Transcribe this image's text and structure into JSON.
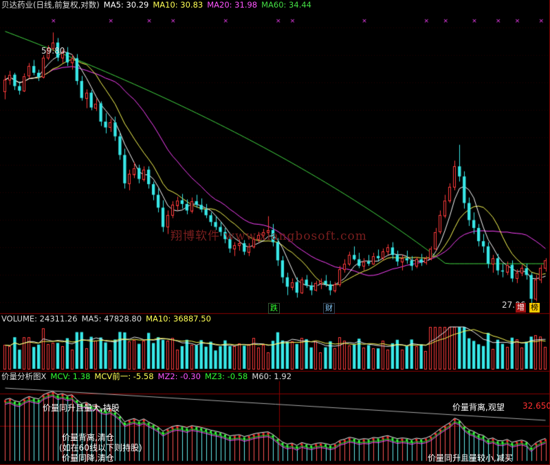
{
  "colors": {
    "up": "#ff3b3b",
    "down": "#38e8e8",
    "ma5": "#ffffff",
    "ma10": "#ffff55",
    "ma20": "#ff44ff",
    "ma60": "#44dd44",
    "divider": "#8b0000",
    "white": "#eeeeee",
    "yellow": "#ffff00",
    "green": "#33ff33",
    "magenta": "#ff55ff",
    "red": "#ff2a2a",
    "wm": "#7a1e1e"
  },
  "header": {
    "name": "贝达药业(日线,前复权,对数)",
    "ma5": "MA5: 30.29",
    "ma10": "MA10: 30.83",
    "ma20": "MA20: 31.98",
    "ma60": "MA60: 34.44"
  },
  "price_panel": {
    "high_label": "59.80",
    "low_label": "27.06",
    "tags": [
      "跌",
      "财",
      "增",
      "榜"
    ]
  },
  "watermark": "翔博软件 www.xiangbosoft.com",
  "volume_header": {
    "volume": "VOLUME: 24311.26",
    "ma5": "MA5: 47828.80",
    "ma10": "MA10: 36887.50"
  },
  "indicator_header": {
    "name": "价量分析图X",
    "mcv": "MCV: 1.38",
    "mcv_prev": "MCV前一: -5.58",
    "mz2": "MZ2: -0.30",
    "mz3": "MZ3: -0.58",
    "m60": "M60: 1.92"
  },
  "indicator_labels": {
    "a": "价量同升且量大,持股",
    "b": "价量背离,观望",
    "c": "价量背离,清仓",
    "d": "(如在60线以下则持股)",
    "e": "价量同降,清仓",
    "f": "价量同升且量较小,减买",
    "value": "32.650"
  },
  "chart_data": {
    "type": "candlestick",
    "series_names": [
      "MA5",
      "MA10",
      "MA20",
      "MA60"
    ],
    "price_range": [
      26,
      62
    ],
    "candles": [
      [
        50.0,
        52.5,
        48.8,
        51.8
      ],
      [
        51.8,
        53.2,
        51.0,
        52.6
      ],
      [
        52.6,
        52.9,
        50.2,
        50.8
      ],
      [
        50.8,
        51.5,
        49.5,
        50.1
      ],
      [
        50.1,
        52.8,
        49.9,
        52.4
      ],
      [
        52.4,
        54.5,
        52.0,
        54.0
      ],
      [
        54.0,
        55.0,
        52.5,
        52.9
      ],
      [
        52.9,
        53.4,
        51.6,
        52.2
      ],
      [
        52.2,
        55.8,
        52.0,
        55.4
      ],
      [
        55.4,
        57.5,
        55.0,
        57.0
      ],
      [
        57.0,
        59.8,
        56.5,
        58.0
      ],
      [
        58.0,
        58.8,
        54.8,
        55.4
      ],
      [
        55.4,
        56.8,
        54.5,
        56.3
      ],
      [
        56.3,
        57.2,
        54.0,
        54.6
      ],
      [
        54.6,
        55.9,
        53.4,
        55.3
      ],
      [
        55.3,
        56.0,
        51.0,
        51.6
      ],
      [
        51.6,
        52.4,
        48.6,
        49.0
      ],
      [
        49.0,
        50.3,
        47.5,
        49.8
      ],
      [
        49.8,
        50.2,
        47.2,
        47.6
      ],
      [
        47.6,
        48.9,
        47.1,
        48.2
      ],
      [
        48.2,
        48.5,
        45.0,
        45.6
      ],
      [
        45.6,
        46.8,
        44.0,
        44.8
      ],
      [
        44.8,
        46.0,
        44.2,
        45.5
      ],
      [
        45.5,
        46.3,
        43.0,
        43.6
      ],
      [
        43.6,
        44.0,
        40.6,
        41.2
      ],
      [
        41.2,
        42.0,
        37.2,
        37.8
      ],
      [
        37.8,
        39.4,
        37.0,
        38.9
      ],
      [
        38.9,
        40.3,
        38.4,
        39.6
      ],
      [
        39.6,
        40.0,
        37.8,
        38.3
      ],
      [
        38.3,
        39.8,
        38.0,
        39.4
      ],
      [
        39.4,
        39.8,
        37.2,
        37.7
      ],
      [
        37.7,
        38.0,
        35.9,
        36.5
      ],
      [
        36.5,
        37.2,
        34.6,
        35.1
      ],
      [
        35.1,
        35.9,
        32.6,
        33.1
      ],
      [
        33.1,
        34.8,
        32.4,
        34.3
      ],
      [
        34.3,
        35.8,
        34.0,
        35.4
      ],
      [
        35.4,
        36.3,
        34.8,
        35.9
      ],
      [
        35.9,
        36.6,
        35.0,
        35.5
      ],
      [
        35.5,
        36.0,
        34.4,
        34.8
      ],
      [
        34.8,
        36.2,
        34.5,
        35.8
      ],
      [
        35.8,
        36.5,
        35.1,
        35.4
      ],
      [
        35.4,
        36.1,
        34.6,
        34.9
      ],
      [
        34.9,
        35.5,
        34.0,
        34.3
      ],
      [
        34.3,
        34.6,
        33.2,
        33.6
      ],
      [
        33.6,
        34.2,
        32.8,
        33.1
      ],
      [
        33.1,
        33.6,
        32.2,
        32.6
      ],
      [
        32.6,
        33.0,
        31.5,
        31.9
      ],
      [
        31.9,
        32.3,
        30.6,
        31.0
      ],
      [
        31.0,
        31.6,
        30.3,
        31.3
      ],
      [
        31.3,
        31.9,
        30.8,
        31.5
      ],
      [
        31.5,
        31.8,
        30.4,
        30.7
      ],
      [
        30.7,
        31.5,
        30.3,
        31.2
      ],
      [
        31.2,
        32.1,
        31.0,
        31.9
      ],
      [
        31.9,
        32.6,
        31.6,
        32.3
      ],
      [
        32.3,
        32.9,
        31.9,
        32.6
      ],
      [
        32.6,
        34.2,
        32.3,
        32.8
      ],
      [
        32.8,
        33.4,
        31.2,
        31.6
      ],
      [
        31.6,
        32.0,
        29.4,
        29.9
      ],
      [
        29.9,
        30.3,
        27.9,
        28.4
      ],
      [
        28.4,
        28.8,
        26.9,
        27.6
      ],
      [
        27.6,
        28.3,
        27.3,
        28.0
      ],
      [
        28.0,
        28.4,
        26.7,
        27.1
      ],
      [
        27.1,
        28.4,
        27.0,
        28.2
      ],
      [
        28.2,
        28.6,
        27.5,
        27.7
      ],
      [
        27.7,
        28.0,
        26.9,
        27.3
      ],
      [
        27.3,
        28.1,
        27.2,
        27.9
      ],
      [
        27.9,
        28.3,
        27.4,
        28.1
      ],
      [
        28.1,
        28.6,
        27.6,
        27.8
      ],
      [
        27.8,
        28.1,
        26.9,
        27.3
      ],
      [
        27.3,
        28.0,
        27.1,
        27.8
      ],
      [
        27.8,
        29.4,
        27.6,
        29.1
      ],
      [
        29.1,
        30.0,
        28.8,
        29.6
      ],
      [
        29.6,
        30.7,
        29.4,
        30.4
      ],
      [
        30.4,
        31.2,
        29.9,
        30.0
      ],
      [
        30.0,
        30.6,
        29.2,
        29.4
      ],
      [
        29.4,
        30.1,
        29.0,
        29.8
      ],
      [
        29.8,
        30.4,
        29.4,
        29.6
      ],
      [
        29.6,
        30.6,
        29.5,
        30.3
      ],
      [
        30.3,
        30.9,
        29.8,
        30.1
      ],
      [
        30.1,
        31.0,
        29.9,
        30.7
      ],
      [
        30.7,
        31.4,
        30.4,
        31.1
      ],
      [
        31.1,
        31.6,
        30.0,
        30.4
      ],
      [
        30.4,
        30.8,
        29.4,
        29.8
      ],
      [
        29.8,
        30.4,
        29.0,
        30.1
      ],
      [
        30.1,
        30.8,
        29.6,
        29.9
      ],
      [
        29.9,
        30.3,
        29.0,
        29.4
      ],
      [
        29.4,
        30.2,
        29.2,
        30.0
      ],
      [
        30.0,
        30.5,
        29.4,
        29.7
      ],
      [
        29.7,
        30.3,
        29.5,
        30.1
      ],
      [
        30.1,
        31.2,
        29.9,
        31.0
      ],
      [
        31.0,
        33.0,
        30.8,
        32.6
      ],
      [
        32.6,
        34.8,
        32.4,
        34.3
      ],
      [
        34.3,
        36.5,
        34.0,
        35.9
      ],
      [
        35.9,
        37.8,
        35.6,
        37.4
      ],
      [
        37.4,
        40.5,
        37.0,
        39.8
      ],
      [
        39.8,
        42.5,
        38.0,
        38.6
      ],
      [
        38.6,
        39.2,
        35.0,
        35.6
      ],
      [
        35.6,
        36.2,
        33.2,
        33.8
      ],
      [
        33.8,
        34.6,
        32.4,
        33.0
      ],
      [
        33.0,
        33.4,
        31.2,
        31.7
      ],
      [
        31.7,
        32.4,
        30.6,
        31.2
      ],
      [
        31.2,
        31.6,
        29.2,
        29.6
      ],
      [
        29.6,
        30.4,
        28.8,
        30.1
      ],
      [
        30.1,
        30.5,
        28.6,
        29.0
      ],
      [
        29.0,
        29.6,
        28.4,
        28.9
      ],
      [
        28.9,
        29.8,
        28.6,
        29.5
      ],
      [
        29.5,
        29.9,
        28.0,
        28.3
      ],
      [
        28.3,
        29.1,
        27.9,
        28.8
      ],
      [
        28.8,
        29.5,
        28.5,
        29.2
      ],
      [
        29.2,
        29.6,
        28.2,
        28.6
      ],
      [
        28.6,
        28.8,
        26.2,
        26.6
      ],
      [
        26.6,
        28.6,
        26.4,
        28.2
      ],
      [
        28.2,
        29.5,
        27.9,
        29.2
      ],
      [
        29.2,
        30.1,
        28.9,
        29.9
      ]
    ]
  }
}
